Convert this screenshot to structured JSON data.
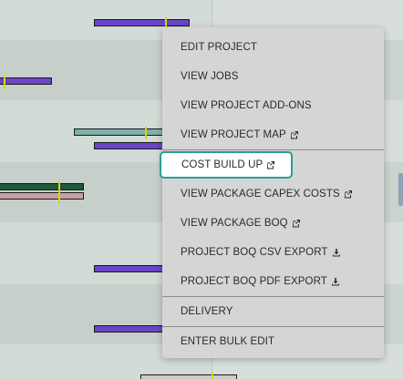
{
  "menu": {
    "items": [
      {
        "label": "EDIT PROJECT",
        "icon": "none"
      },
      {
        "label": "VIEW JOBS",
        "icon": "none"
      },
      {
        "label": "VIEW PROJECT ADD-ONS",
        "icon": "none"
      },
      {
        "label": "VIEW PROJECT MAP",
        "icon": "external-link-icon"
      },
      {
        "label": "COST BUILD UP",
        "icon": "external-link-icon",
        "focused": true
      },
      {
        "label": "VIEW PACKAGE CAPEX COSTS",
        "icon": "external-link-icon"
      },
      {
        "label": "VIEW PACKAGE BOQ",
        "icon": "external-link-icon"
      },
      {
        "label": "PROJECT BOQ CSV EXPORT",
        "icon": "download-icon"
      },
      {
        "label": "PROJECT BOQ PDF EXPORT",
        "icon": "download-icon"
      },
      {
        "label": "DELIVERY",
        "icon": "none"
      },
      {
        "label": "ENTER BULK EDIT",
        "icon": "none"
      }
    ]
  },
  "colors": {
    "menu_bg": "#d5d5d5",
    "focus_border": "#2a9d93",
    "bar_purple": "#6a45c8",
    "bar_teal": "#7fb0a8",
    "bar_green": "#1f5a3a",
    "bar_pink": "#c7a0a6",
    "marker_yellow": "#d8d400"
  }
}
